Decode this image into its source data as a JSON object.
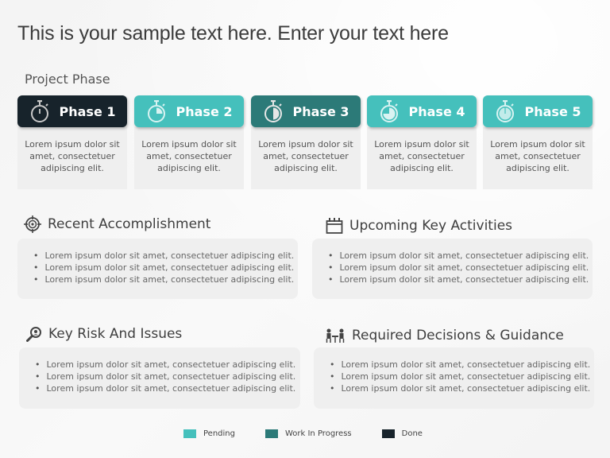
{
  "title": "This is your sample text here. Enter your text here",
  "project_phase_label": "Project Phase",
  "colors": {
    "pending": "#45c0bc",
    "work_in_progress": "#2c7a78",
    "done": "#17232b"
  },
  "phases": [
    {
      "label": "Phase 1",
      "status": "done",
      "icon": "stopwatch-empty-icon",
      "text": "Lorem ipsum dolor sit amet, consectetuer adipiscing elit.",
      "fill_fraction": 0
    },
    {
      "label": "Phase 2",
      "status": "pending",
      "icon": "stopwatch-quarter-icon",
      "text": "Lorem ipsum dolor sit amet, consectetuer adipiscing elit.",
      "fill_fraction": 0.25
    },
    {
      "label": "Phase 3",
      "status": "work_in_progress",
      "icon": "stopwatch-half-icon",
      "text": "Lorem ipsum dolor sit amet, consectetuer adipiscing elit.",
      "fill_fraction": 0.5
    },
    {
      "label": "Phase 4",
      "status": "pending",
      "icon": "stopwatch-three-quarter-icon",
      "text": "Lorem ipsum dolor sit amet, consectetuer adipiscing elit.",
      "fill_fraction": 0.75
    },
    {
      "label": "Phase 5",
      "status": "pending",
      "icon": "stopwatch-full-icon",
      "text": "Lorem ipsum dolor sit amet, consectetuer adipiscing elit.",
      "fill_fraction": 1
    }
  ],
  "sections": {
    "recent": {
      "title": "Recent Accomplishment",
      "icon": "target-icon",
      "items": [
        "Lorem ipsum dolor sit amet, consectetuer adipiscing elit.",
        "Lorem ipsum dolor sit amet, consectetuer adipiscing elit.",
        "Lorem ipsum dolor sit amet, consectetuer adipiscing elit."
      ]
    },
    "upcoming": {
      "title": "Upcoming Key Activities",
      "icon": "calendar-icon",
      "items": [
        "Lorem ipsum dolor sit amet, consectetuer adipiscing elit.",
        "Lorem ipsum dolor sit amet, consectetuer adipiscing elit.",
        "Lorem ipsum dolor sit amet, consectetuer adipiscing elit."
      ]
    },
    "risks": {
      "title": "Key Risk And Issues",
      "icon": "magnifier-icon",
      "items": [
        "Lorem ipsum dolor sit amet, consectetuer adipiscing elit.",
        "Lorem ipsum dolor sit amet, consectetuer adipiscing elit.",
        "Lorem ipsum dolor sit amet, consectetuer adipiscing elit."
      ]
    },
    "decisions": {
      "title": "Required Decisions & Guidance",
      "icon": "meeting-icon",
      "items": [
        "Lorem ipsum dolor sit amet, consectetuer adipiscing elit.",
        "Lorem ipsum dolor sit amet, consectetuer adipiscing elit.",
        "Lorem ipsum dolor sit amet, consectetuer adipiscing elit."
      ]
    }
  },
  "legend": [
    {
      "label": "Pending",
      "status": "pending"
    },
    {
      "label": "Work In Progress",
      "status": "work_in_progress"
    },
    {
      "label": "Done",
      "status": "done"
    }
  ]
}
